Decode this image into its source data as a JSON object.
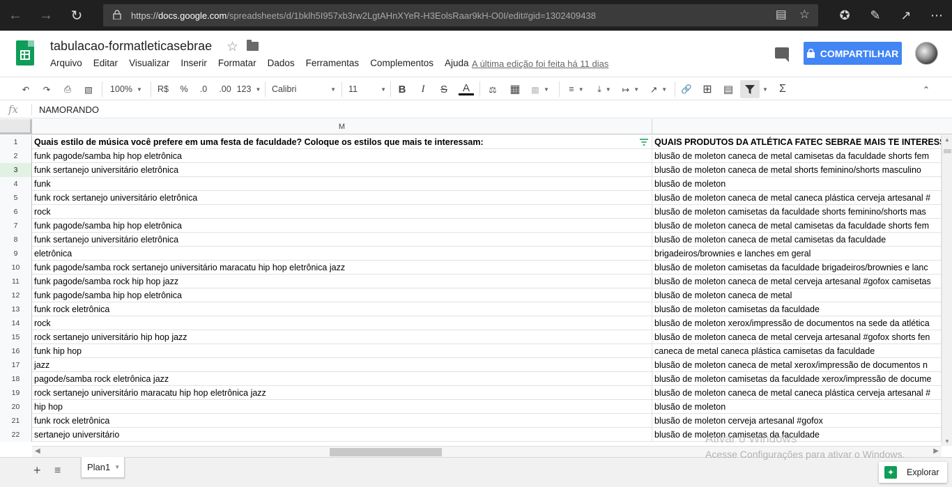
{
  "browser": {
    "url_prefix": "https://",
    "url_host": "docs.google.com",
    "url_path": "/spreadsheets/d/1bklh5I957xb3rw2LgtAHnXYeR-H3EolsRaar9kH-O0I/edit#gid=1302409438"
  },
  "doc": {
    "title": "tabulacao-formatleticasebrae",
    "menu": [
      "Arquivo",
      "Editar",
      "Visualizar",
      "Inserir",
      "Formatar",
      "Dados",
      "Ferramentas",
      "Complementos",
      "Ajuda"
    ],
    "last_edit": "A última edição foi feita há 11 dias",
    "share_label": "COMPARTILHAR"
  },
  "toolbar": {
    "zoom": "100%",
    "currency": "R$",
    "percent": "%",
    "dec_less": ".0",
    "dec_more": ".00",
    "number_format": "123",
    "font": "Calibri",
    "font_size": "11"
  },
  "formula_bar": {
    "fx": "fx",
    "value": "NAMORANDO"
  },
  "columns": {
    "m": "M",
    "n": ""
  },
  "rows": [
    {
      "n": "1",
      "m": "Quais estilo de música você prefere em uma festa de faculdade? Coloque os estilos que mais te interessam:",
      "p": "QUAIS PRODUTOS DA ATLÉTICA FATEC SEBRAE MAIS TE INTERESSAM"
    },
    {
      "n": "2",
      "m": "funk pagode/samba hip hop eletrônica",
      "p": "blusão de moleton caneca de metal camisetas da faculdade shorts fem"
    },
    {
      "n": "3",
      "m": "funk sertanejo universitário eletrônica",
      "p": "blusão de moleton caneca de metal shorts feminino/shorts masculino"
    },
    {
      "n": "4",
      "m": "funk",
      "p": "blusão de moleton"
    },
    {
      "n": "5",
      "m": "funk rock sertanejo universitário eletrônica",
      "p": "blusão de moleton caneca de metal caneca plástica cerveja artesanal #"
    },
    {
      "n": "6",
      "m": "rock",
      "p": "blusão de moleton camisetas da faculdade shorts feminino/shorts mas"
    },
    {
      "n": "7",
      "m": "funk pagode/samba hip hop eletrônica",
      "p": "blusão de moleton caneca de metal camisetas da faculdade shorts fem"
    },
    {
      "n": "8",
      "m": "funk sertanejo universitário eletrônica",
      "p": "blusão de moleton caneca de metal camisetas da faculdade"
    },
    {
      "n": "9",
      "m": "eletrônica",
      "p": "brigadeiros/brownies e lanches em geral"
    },
    {
      "n": "10",
      "m": "funk pagode/samba rock sertanejo universitário maracatu hip hop eletrônica jazz",
      "p": "blusão de moleton camisetas da faculdade brigadeiros/brownies e lanc"
    },
    {
      "n": "11",
      "m": "funk pagode/samba rock hip hop jazz",
      "p": "blusão de moleton caneca de metal cerveja artesanal #gofox camisetas"
    },
    {
      "n": "12",
      "m": "funk pagode/samba hip hop eletrônica",
      "p": "blusão de moleton caneca de metal"
    },
    {
      "n": "13",
      "m": "funk rock eletrônica",
      "p": "blusão de moleton camisetas da faculdade"
    },
    {
      "n": "14",
      "m": "rock",
      "p": "blusão de moleton xerox/impressão de documentos na sede da atlética"
    },
    {
      "n": "15",
      "m": "rock sertanejo universitário hip hop jazz",
      "p": "blusão de moleton caneca de metal cerveja artesanal #gofox shorts fen"
    },
    {
      "n": "16",
      "m": "funk hip hop",
      "p": "caneca de metal caneca plástica camisetas da faculdade"
    },
    {
      "n": "17",
      "m": "jazz",
      "p": "blusão de moleton caneca de metal xerox/impressão de documentos n"
    },
    {
      "n": "18",
      "m": "pagode/samba rock eletrônica jazz",
      "p": "blusão de moleton camisetas da faculdade xerox/impressão de docume"
    },
    {
      "n": "19",
      "m": "rock sertanejo universitário maracatu hip hop eletrônica jazz",
      "p": "blusão de moleton caneca de metal caneca plástica cerveja artesanal #"
    },
    {
      "n": "20",
      "m": "hip hop",
      "p": "blusão de moleton"
    },
    {
      "n": "21",
      "m": "funk rock eletrônica",
      "p": "blusão de moleton cerveja artesanal #gofox"
    },
    {
      "n": "22",
      "m": "sertanejo universitário",
      "p": "blusão de moleton camisetas da faculdade"
    }
  ],
  "selected_row": "3",
  "sheets": {
    "tab": "Plan1",
    "explore_label": "Explorar"
  },
  "watermark": {
    "line1": "Ativar o Windows",
    "line2": "Acesse Configurações para ativar o Windows."
  },
  "colors": {
    "accent": "#4285f4",
    "brand": "#0f9d58",
    "browser_bg": "#202020",
    "selected_row": "#e1f2e3"
  }
}
